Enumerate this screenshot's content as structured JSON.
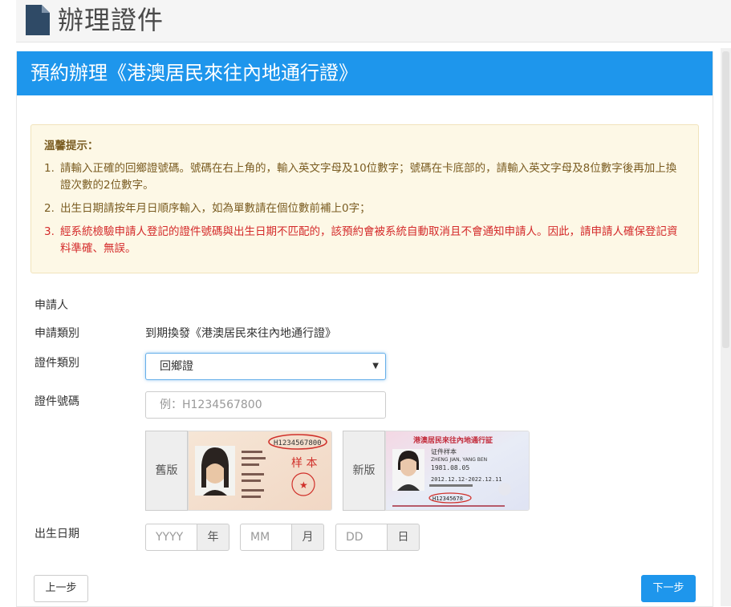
{
  "header": {
    "title": "辦理證件",
    "icon": "document-icon"
  },
  "card": {
    "title": "預約辦理《港澳居民來往內地通行證》"
  },
  "notice": {
    "title": "溫馨提示：",
    "items": [
      "請輸入正確的回鄉證號碼。號碼在右上角的，輸入英文字母及10位數字；號碼在卡底部的，請輸入英文字母及8位數字後再加上換證次數的2位數字。",
      "出生日期請按年月日順序輸入，如為單數請在個位數前補上0字；",
      "經系統檢驗申請人登記的證件號碼與出生日期不匹配的，該預約會被系統自動取消且不會通知申請人。因此，請申請人確保登記資料準確、無誤。"
    ],
    "numbers": [
      "1.",
      "2.",
      "3."
    ]
  },
  "form": {
    "section": "申請人",
    "apply_type": {
      "label": "申請類別",
      "value": "到期換發《港澳居民來往內地通行證》"
    },
    "doc_type": {
      "label": "證件類別",
      "value": "回鄉證"
    },
    "doc_number": {
      "label": "證件號碼",
      "placeholder": "例：H1234567800"
    },
    "samples": {
      "old": {
        "label": "舊版",
        "number": "H1234567800",
        "stamp": "样 本"
      },
      "new": {
        "label": "新版",
        "title": "港澳居民來往內地通行証",
        "number": "H12345678",
        "sample": "证件样本",
        "name": "ZHENG JIAN, YANG BEN",
        "dob": "1981.08.05",
        "validity": "2012.12.12-2022.12.11"
      }
    },
    "dob": {
      "label": "出生日期",
      "year": {
        "placeholder": "YYYY",
        "unit": "年"
      },
      "month": {
        "placeholder": "MM",
        "unit": "月"
      },
      "day": {
        "placeholder": "DD",
        "unit": "日"
      }
    }
  },
  "buttons": {
    "prev": "上一步",
    "next": "下一步"
  },
  "colors": {
    "primary": "#1e96ec",
    "warning_text": "#d42a2a",
    "notice_bg": "#fdf8e6"
  }
}
